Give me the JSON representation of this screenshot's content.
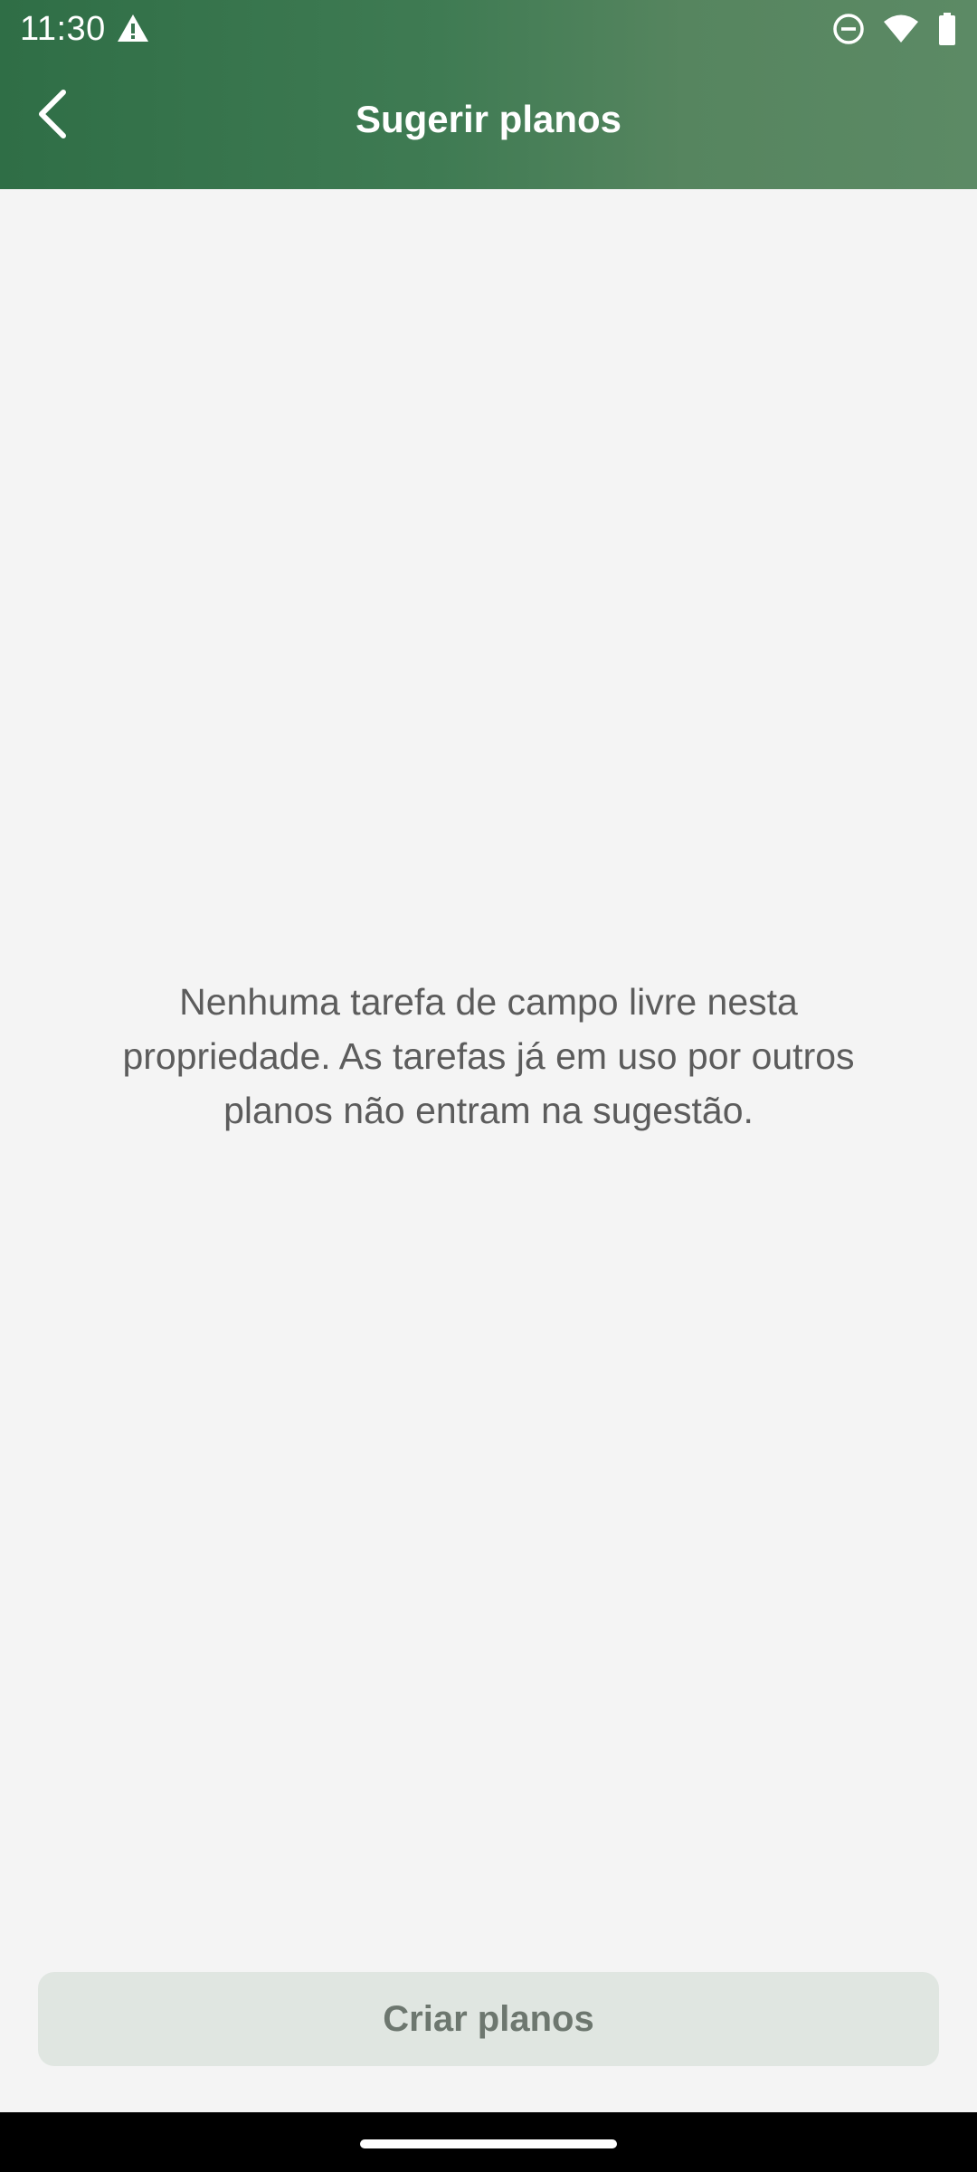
{
  "status_bar": {
    "time": "11:30",
    "icons": [
      "alert-triangle-icon",
      "do-not-disturb-icon",
      "wifi-icon",
      "battery-icon"
    ]
  },
  "app_bar": {
    "title": "Sugerir planos",
    "back_icon": "chevron-left-icon"
  },
  "main": {
    "empty_message": "Nenhuma tarefa de campo livre nesta propriedade. As tarefas já em uso por outros planos não entram na sugestão."
  },
  "actions": {
    "create_label": "Criar planos",
    "create_enabled": false
  },
  "colors": {
    "header_start": "#2f6e46",
    "header_end": "#5c8a65",
    "background": "#f4f4f4",
    "button_disabled_bg": "#e0e6e1",
    "button_disabled_text": "#6d776f"
  }
}
